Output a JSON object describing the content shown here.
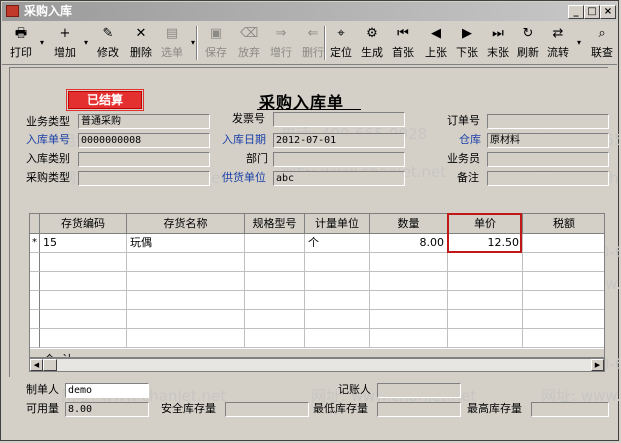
{
  "window": {
    "title": "采购入库"
  },
  "toolbar": [
    {
      "id": "print",
      "label": "打印",
      "icon": "printer-icon",
      "glyph": "🖶",
      "enabled": true
    },
    {
      "id": "add",
      "label": "增加",
      "icon": "add-icon",
      "glyph": "+",
      "enabled": true
    },
    {
      "id": "edit",
      "label": "修改",
      "icon": "edit-icon",
      "glyph": "✎",
      "enabled": true
    },
    {
      "id": "delete",
      "label": "删除",
      "icon": "delete-icon",
      "glyph": "✕",
      "enabled": true
    },
    {
      "id": "select",
      "label": "选单",
      "icon": "select-order-icon",
      "glyph": "▤",
      "enabled": false
    },
    {
      "id": "save",
      "label": "保存",
      "icon": "save-icon",
      "glyph": "▣",
      "enabled": false
    },
    {
      "id": "abandon",
      "label": "放弃",
      "icon": "abandon-icon",
      "glyph": "⌫",
      "enabled": false
    },
    {
      "id": "addrow",
      "label": "增行",
      "icon": "add-row-icon",
      "glyph": "⇒",
      "enabled": false
    },
    {
      "id": "delrow",
      "label": "删行",
      "icon": "delete-row-icon",
      "glyph": "⇐",
      "enabled": false
    },
    {
      "id": "locate",
      "label": "定位",
      "icon": "locate-icon",
      "glyph": "⌖",
      "enabled": true
    },
    {
      "id": "generate",
      "label": "生成",
      "icon": "generate-icon",
      "glyph": "⚙",
      "enabled": true
    },
    {
      "id": "first",
      "label": "首张",
      "icon": "first-record-icon",
      "glyph": "⏮",
      "enabled": true
    },
    {
      "id": "prev",
      "label": "上张",
      "icon": "previous-record-icon",
      "glyph": "◀",
      "enabled": true
    },
    {
      "id": "next",
      "label": "下张",
      "icon": "next-record-icon",
      "glyph": "▶",
      "enabled": true
    },
    {
      "id": "last",
      "label": "末张",
      "icon": "last-record-icon",
      "glyph": "⏭",
      "enabled": true
    },
    {
      "id": "refresh",
      "label": "刷新",
      "icon": "refresh-icon",
      "glyph": "↻",
      "enabled": true
    },
    {
      "id": "flow",
      "label": "流转",
      "icon": "flow-icon",
      "glyph": "⇄",
      "enabled": true
    },
    {
      "id": "query",
      "label": "联查",
      "icon": "linked-query-icon",
      "glyph": "⌕",
      "enabled": true
    }
  ],
  "form": {
    "title": "采购入库单",
    "status_stamp": "已结算",
    "labels": {
      "business_type": "业务类型",
      "invoice_no": "发票号",
      "order_no": "订单号",
      "receipt_no": "入库单号",
      "receipt_date": "入库日期",
      "warehouse": "仓库",
      "receipt_category": "入库类别",
      "department": "部门",
      "salesman": "业务员",
      "purchase_type": "采购类型",
      "supplier": "供货单位",
      "remark": "备注"
    },
    "values": {
      "business_type": "普通采购",
      "invoice_no": "",
      "order_no": "",
      "receipt_no": "0000000008",
      "receipt_date": "2012-07-01",
      "warehouse": "原材料",
      "receipt_category": "",
      "department": "",
      "salesman": "",
      "purchase_type": "",
      "supplier": "abc",
      "remark": ""
    }
  },
  "grid": {
    "columns": [
      "存货编码",
      "存货名称",
      "规格型号",
      "计量单位",
      "数量",
      "单价",
      "税额"
    ],
    "rows": [
      {
        "marker": "*",
        "code": "15",
        "name": "玩偶",
        "spec": "",
        "unit": "个",
        "qty": "8.00",
        "price": "12.50",
        "tax": ""
      }
    ],
    "summary_label": "合  计"
  },
  "footer": {
    "labels": {
      "maker": "制单人",
      "bookkeeper": "记账人",
      "available": "可用量",
      "safety_stock": "安全库存量",
      "min_stock": "最低库存量",
      "max_stock": "最高库存量"
    },
    "values": {
      "maker": "demo",
      "bookkeeper": "",
      "available": "8.00",
      "safety_stock": "",
      "min_stock": "",
      "max_stock": ""
    }
  },
  "watermark": {
    "phone": "电话: 400-665-0028",
    "site": "网址: www.chanjet.net"
  },
  "colors": {
    "status_red": "#e53030",
    "label_blue": "#1a3fa8",
    "highlight": "#c01818"
  }
}
